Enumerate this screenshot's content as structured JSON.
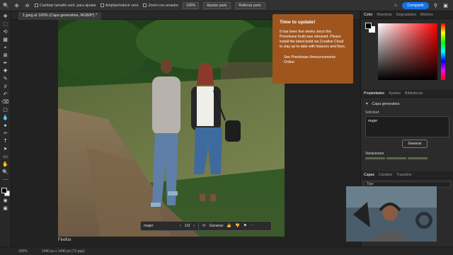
{
  "options_bar": {
    "resize_label": "Cambiar tamaño vent. para ajustar",
    "zoom_all_label": "Ampliar/reducir vent.",
    "scrubby_label": "Zoom con arrastre",
    "zoom_value": "100%",
    "fit_label": "Ajustar pant.",
    "fill_label": "Rellenar pant.",
    "share_label": "Compartir"
  },
  "document": {
    "tab_label": "1.jpeg al 100% (Capa generativa, RGB/8*) *",
    "caption": "Firefox"
  },
  "generative_bar": {
    "prompt": "mujer",
    "counter": "1/3",
    "generate_label": "Generar"
  },
  "notification": {
    "title": "Time to update!",
    "body": "It has been five weeks since this Prerelease build was released. Please install the latest build via Creative Cloud to stay up-to-date with features and fixes.",
    "link": "See Prerelease Announcements Online"
  },
  "color_panel": {
    "tabs": [
      "Color",
      "Muestras",
      "Degradados",
      "Motivos"
    ]
  },
  "properties_panel": {
    "tabs": [
      "Propiedades",
      "Ajustes",
      "Bibliotecas"
    ],
    "layer_type": "Capa generativa",
    "prompt_label": "Solicitud:",
    "prompt_value": "mujer",
    "generate_label": "Generar",
    "variations_label": "Variaciones"
  },
  "layers_panel": {
    "tabs": [
      "Capas",
      "Canales",
      "Trazados"
    ],
    "filter_label": "Tipo"
  },
  "status_bar": {
    "zoom": "100%",
    "doc_info": "1440 px x 1440 px (72 ppp)"
  }
}
